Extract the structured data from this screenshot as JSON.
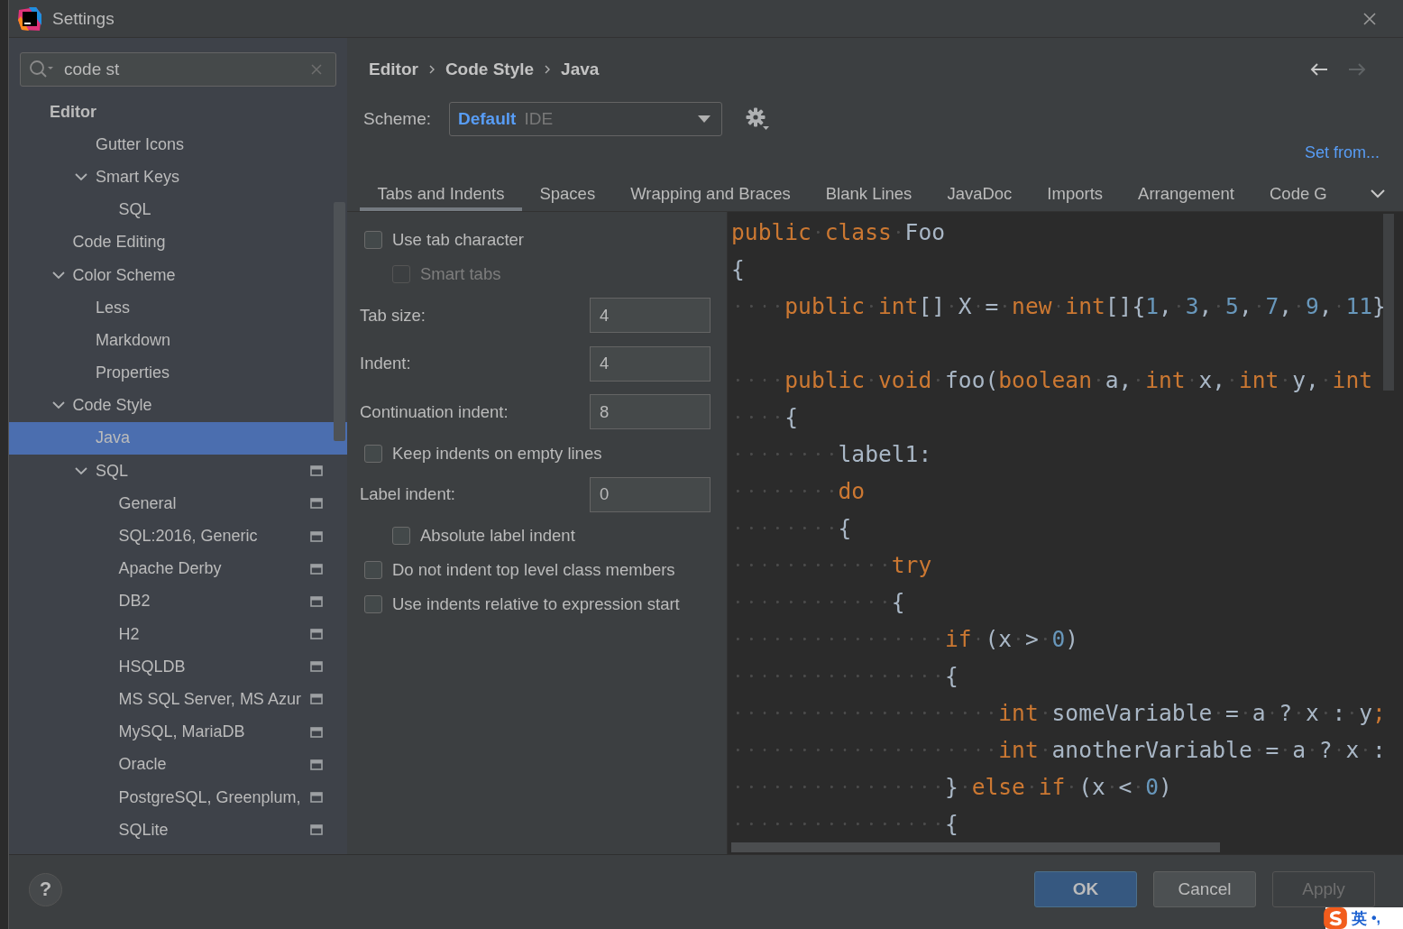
{
  "window": {
    "title": "Settings"
  },
  "search": {
    "value": "code st"
  },
  "tree": [
    {
      "label": "Editor",
      "kind": "header",
      "selected": false,
      "project_scoped": false,
      "children": [
        {
          "label": "Gutter Icons",
          "kind": "orphan",
          "selected": false,
          "project_scoped": false
        },
        {
          "label": "Smart Keys",
          "kind": "orphan",
          "selected": false,
          "expanded": true,
          "project_scoped": false,
          "children": [
            {
              "label": "SQL",
              "kind": "item",
              "selected": false,
              "project_scoped": false
            }
          ]
        },
        {
          "label": "Code Editing",
          "kind": "item",
          "selected": false,
          "project_scoped": false
        },
        {
          "label": "Color Scheme",
          "kind": "item",
          "selected": false,
          "expanded": true,
          "project_scoped": false,
          "children": [
            {
              "label": "Less",
              "kind": "item",
              "selected": false,
              "project_scoped": false
            },
            {
              "label": "Markdown",
              "kind": "item",
              "selected": false,
              "project_scoped": false
            },
            {
              "label": "Properties",
              "kind": "item",
              "selected": false,
              "project_scoped": false
            }
          ]
        },
        {
          "label": "Code Style",
          "kind": "item",
          "selected": false,
          "expanded": true,
          "project_scoped": false,
          "children": [
            {
              "label": "Java",
              "kind": "item",
              "selected": true,
              "project_scoped": false
            },
            {
              "label": "SQL",
              "kind": "item",
              "selected": false,
              "expanded": true,
              "project_scoped": true,
              "children": [
                {
                  "label": "General",
                  "kind": "item",
                  "selected": false,
                  "project_scoped": true
                },
                {
                  "label": "SQL:2016, Generic",
                  "kind": "item",
                  "selected": false,
                  "project_scoped": true
                },
                {
                  "label": "Apache Derby",
                  "kind": "item",
                  "selected": false,
                  "project_scoped": true
                },
                {
                  "label": "DB2",
                  "kind": "item",
                  "selected": false,
                  "project_scoped": true
                },
                {
                  "label": "H2",
                  "kind": "item",
                  "selected": false,
                  "project_scoped": true
                },
                {
                  "label": "HSQLDB",
                  "kind": "item",
                  "selected": false,
                  "project_scoped": true
                },
                {
                  "label": "MS SQL Server, MS Azur",
                  "kind": "item",
                  "selected": false,
                  "project_scoped": true
                },
                {
                  "label": "MySQL, MariaDB",
                  "kind": "item",
                  "selected": false,
                  "project_scoped": true
                },
                {
                  "label": "Oracle",
                  "kind": "item",
                  "selected": false,
                  "project_scoped": true
                },
                {
                  "label": "PostgreSQL, Greenplum,",
                  "kind": "item",
                  "selected": false,
                  "project_scoped": true
                },
                {
                  "label": "SQLite",
                  "kind": "item",
                  "selected": false,
                  "project_scoped": true
                }
              ]
            }
          ]
        }
      ]
    }
  ],
  "breadcrumb": [
    "Editor",
    "Code Style",
    "Java"
  ],
  "nav": [
    {
      "kind": "back",
      "disabled": false
    },
    {
      "kind": "forward",
      "disabled": true
    }
  ],
  "scheme": {
    "label": "Scheme:",
    "name": "Default",
    "scope": "IDE"
  },
  "set_from": "Set from...",
  "tabs": [
    {
      "label": "Tabs and Indents",
      "selected": true
    },
    {
      "label": "Spaces",
      "selected": false
    },
    {
      "label": "Wrapping and Braces",
      "selected": false
    },
    {
      "label": "Blank Lines",
      "selected": false
    },
    {
      "label": "JavaDoc",
      "selected": false
    },
    {
      "label": "Imports",
      "selected": false
    },
    {
      "label": "Arrangement",
      "selected": false
    },
    {
      "label": "Code G",
      "selected": false
    }
  ],
  "options": [
    {
      "kind": "checkbox",
      "label": "Use tab character",
      "checked": false,
      "disabled": false,
      "children": [
        {
          "kind": "checkbox",
          "label": "Smart tabs",
          "checked": false,
          "disabled": true
        }
      ]
    },
    {
      "kind": "field",
      "label": "Tab size:",
      "value": "4"
    },
    {
      "kind": "field",
      "label": "Indent:",
      "value": "4"
    },
    {
      "kind": "field",
      "label": "Continuation indent:",
      "value": "8"
    },
    {
      "kind": "checkbox",
      "label": "Keep indents on empty lines",
      "checked": false,
      "disabled": false
    },
    {
      "kind": "field",
      "label": "Label indent:",
      "value": "0",
      "children": [
        {
          "kind": "checkbox",
          "label": "Absolute label indent",
          "checked": false,
          "disabled": false
        }
      ]
    },
    {
      "kind": "checkbox",
      "label": "Do not indent top level class members",
      "checked": false,
      "disabled": false
    },
    {
      "kind": "checkbox",
      "label": "Use indents relative to expression start",
      "checked": false,
      "disabled": false
    }
  ],
  "code_preview": [
    {
      "kind": "code",
      "tokens": [
        {
          "kind": "keyword",
          "text": "public class"
        },
        {
          "kind": "plain",
          "text": " Foo"
        }
      ]
    },
    {
      "kind": "code",
      "tokens": [
        {
          "kind": "plain",
          "text": "{"
        }
      ]
    },
    {
      "kind": "code",
      "tokens": [
        {
          "kind": "keyword",
          "text": "    public int"
        },
        {
          "kind": "plain",
          "text": "[] X = "
        },
        {
          "kind": "keyword",
          "text": "new int"
        },
        {
          "kind": "plain",
          "text": "[]{"
        },
        {
          "kind": "number",
          "text": "1"
        },
        {
          "kind": "plain",
          "text": ", "
        },
        {
          "kind": "number",
          "text": "3"
        },
        {
          "kind": "plain",
          "text": ", "
        },
        {
          "kind": "number",
          "text": "5"
        },
        {
          "kind": "plain",
          "text": ", "
        },
        {
          "kind": "number",
          "text": "7"
        },
        {
          "kind": "plain",
          "text": ", "
        },
        {
          "kind": "number",
          "text": "9"
        },
        {
          "kind": "plain",
          "text": ", "
        },
        {
          "kind": "number",
          "text": "11"
        },
        {
          "kind": "plain",
          "text": "}"
        }
      ]
    },
    {
      "kind": "blank"
    },
    {
      "kind": "code",
      "tokens": [
        {
          "kind": "keyword",
          "text": "    public void"
        },
        {
          "kind": "plain",
          "text": " foo("
        },
        {
          "kind": "keyword",
          "text": "boolean"
        },
        {
          "kind": "plain",
          "text": " a, "
        },
        {
          "kind": "keyword",
          "text": "int"
        },
        {
          "kind": "plain",
          "text": " x, "
        },
        {
          "kind": "keyword",
          "text": "int"
        },
        {
          "kind": "plain",
          "text": " y, "
        },
        {
          "kind": "keyword",
          "text": "int"
        }
      ]
    },
    {
      "kind": "code",
      "tokens": [
        {
          "kind": "plain",
          "text": "    {"
        }
      ]
    },
    {
      "kind": "code",
      "tokens": [
        {
          "kind": "plain",
          "text": "        label1:"
        }
      ]
    },
    {
      "kind": "code",
      "tokens": [
        {
          "kind": "keyword",
          "text": "        do"
        }
      ]
    },
    {
      "kind": "code",
      "tokens": [
        {
          "kind": "plain",
          "text": "        {"
        }
      ]
    },
    {
      "kind": "code",
      "tokens": [
        {
          "kind": "keyword",
          "text": "            try"
        }
      ]
    },
    {
      "kind": "code",
      "tokens": [
        {
          "kind": "plain",
          "text": "            {"
        }
      ]
    },
    {
      "kind": "code",
      "tokens": [
        {
          "kind": "keyword",
          "text": "                if"
        },
        {
          "kind": "plain",
          "text": " (x > "
        },
        {
          "kind": "number",
          "text": "0"
        },
        {
          "kind": "plain",
          "text": ")"
        }
      ]
    },
    {
      "kind": "code",
      "tokens": [
        {
          "kind": "plain",
          "text": "                {"
        }
      ]
    },
    {
      "kind": "code",
      "tokens": [
        {
          "kind": "keyword",
          "text": "                    int"
        },
        {
          "kind": "plain",
          "text": " someVariable = a ? x : y"
        },
        {
          "kind": "keyword",
          "text": ";"
        }
      ]
    },
    {
      "kind": "code",
      "tokens": [
        {
          "kind": "keyword",
          "text": "                    int"
        },
        {
          "kind": "plain",
          "text": " anotherVariable = a ? x :"
        }
      ]
    },
    {
      "kind": "code",
      "tokens": [
        {
          "kind": "plain",
          "text": "                } "
        },
        {
          "kind": "keyword",
          "text": "else if"
        },
        {
          "kind": "plain",
          "text": " (x < "
        },
        {
          "kind": "number",
          "text": "0"
        },
        {
          "kind": "plain",
          "text": ")"
        }
      ]
    },
    {
      "kind": "code",
      "tokens": [
        {
          "kind": "plain",
          "text": "                {"
        }
      ]
    }
  ],
  "help": {
    "label": "?"
  },
  "buttons": [
    {
      "label": "OK",
      "kind": "primary"
    },
    {
      "label": "Cancel",
      "kind": "normal"
    },
    {
      "label": "Apply",
      "kind": "disabled"
    }
  ],
  "ime_toolbar": {
    "mode": "英",
    "punctuation": "•,"
  }
}
